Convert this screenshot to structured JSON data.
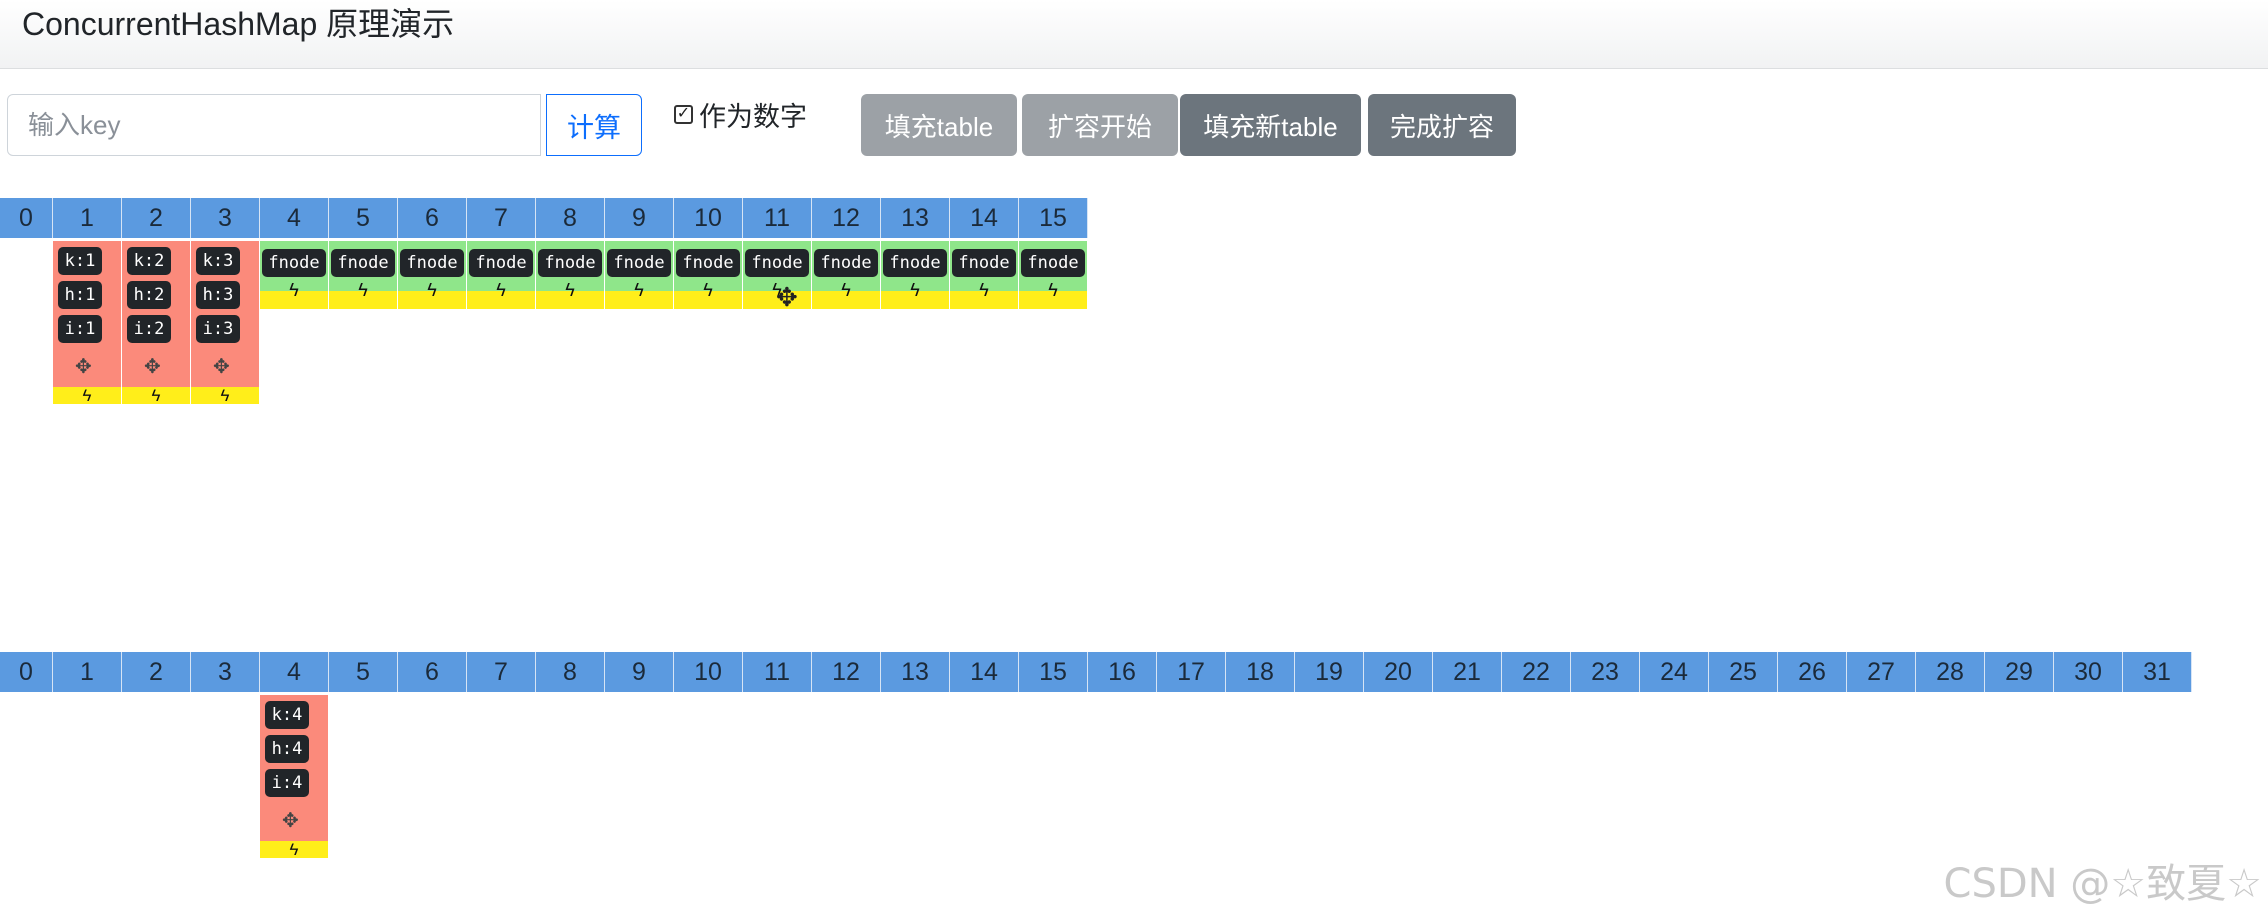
{
  "title": "ConcurrentHashMap 原理演示",
  "toolbar": {
    "key_placeholder": "输入key",
    "calc_label": "计算",
    "as_number_label": "作为数字",
    "as_number_checked": true,
    "buttons": [
      "填充table",
      "扩容开始",
      "填充新table",
      "完成扩容"
    ]
  },
  "old_table": {
    "indices": [
      "0",
      "1",
      "2",
      "3",
      "4",
      "5",
      "6",
      "7",
      "8",
      "9",
      "10",
      "11",
      "12",
      "13",
      "14",
      "15"
    ],
    "nodes": [
      {
        "index": 1,
        "k": "k:1",
        "h": "h:1",
        "i": "i:1"
      },
      {
        "index": 2,
        "k": "k:2",
        "h": "h:2",
        "i": "i:2"
      },
      {
        "index": 3,
        "k": "k:3",
        "h": "h:3",
        "i": "i:3"
      }
    ],
    "forwarding_label": "fnode",
    "forwarding_from": 4,
    "forwarding_to": 15
  },
  "new_table": {
    "indices": [
      "0",
      "1",
      "2",
      "3",
      "4",
      "5",
      "6",
      "7",
      "8",
      "9",
      "10",
      "11",
      "12",
      "13",
      "14",
      "15",
      "16",
      "17",
      "18",
      "19",
      "20",
      "21",
      "22",
      "23",
      "24",
      "25",
      "26",
      "27",
      "28",
      "29",
      "30",
      "31"
    ],
    "nodes": [
      {
        "index": 4,
        "k": "k:4",
        "h": "h:4",
        "i": "i:4"
      }
    ]
  },
  "icons": {
    "move": "move-icon",
    "bolt": "bolt-icon"
  },
  "colors": {
    "index_bg": "#5b9ae0",
    "node_bg": "#fb8a7b",
    "forward_bg": "#8fe68a",
    "highlight": "#ffee1a",
    "pill_bg": "#212529"
  },
  "watermark": "CSDN @☆致夏☆"
}
